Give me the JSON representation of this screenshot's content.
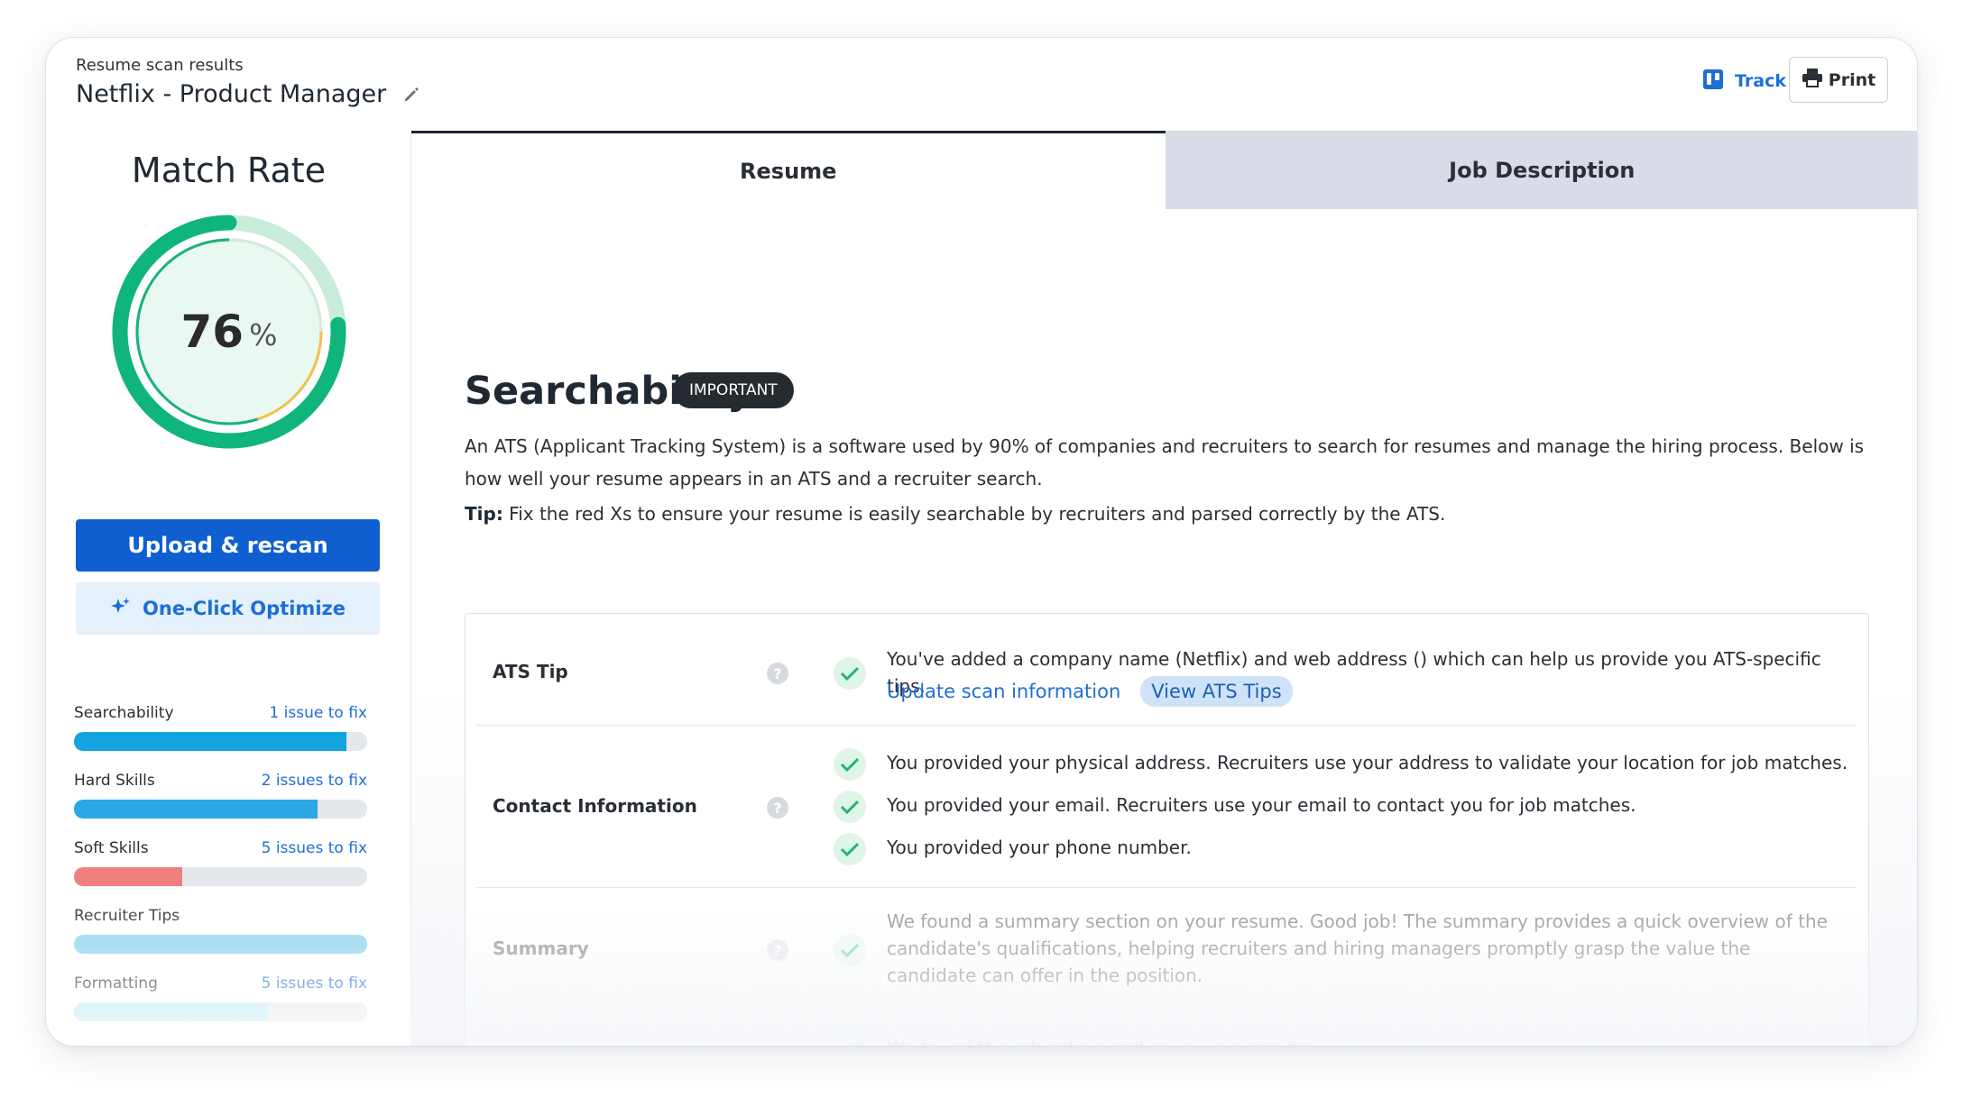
{
  "header": {
    "subtitle": "Resume scan results",
    "title": "Netflix - Product Manager",
    "track_label": "Track",
    "print_label": "Print"
  },
  "sidebar": {
    "match_title": "Match Rate",
    "match_value": "76",
    "match_unit": "%",
    "match_fraction": 0.76,
    "upload_label": "Upload & rescan",
    "optimize_label": "One-Click Optimize",
    "categories": [
      {
        "name": "Searchability",
        "issues": "1 issue to fix",
        "fill": 0.93,
        "color": "#12a3e0"
      },
      {
        "name": "Hard Skills",
        "issues": "2 issues to fix",
        "fill": 0.83,
        "color": "#2ba7e4"
      },
      {
        "name": "Soft Skills",
        "issues": "5 issues to fix",
        "fill": 0.37,
        "color": "#f08080"
      },
      {
        "name": "Recruiter Tips",
        "issues": "",
        "fill": 1.0,
        "color": "#8fd1f0"
      },
      {
        "name": "Formatting",
        "issues": "5 issues to fix",
        "fill": 0.66,
        "color": "#b9e4f6"
      }
    ]
  },
  "tabs": [
    {
      "label": "Resume",
      "active": true
    },
    {
      "label": "Job Description",
      "active": false
    }
  ],
  "main": {
    "section_title": "Searchability",
    "badge": "IMPORTANT",
    "description": "An ATS (Applicant Tracking System) is a software used by 90% of companies and recruiters to search for resumes and manage the hiring process. Below is how well your resume appears in an ATS and a recruiter search.",
    "tip_label": "Tip:",
    "tip_text": " Fix the red Xs to ensure your resume is easily searchable by recruiters and parsed correctly by the ATS.",
    "rows": {
      "ats_tip": {
        "label": "ATS Tip",
        "message": "You've added a company name (Netflix) and web address () which can help us provide you ATS-specific tips.",
        "link": "Update scan information",
        "pill": "View ATS Tips"
      },
      "contact": {
        "label": "Contact Information",
        "messages": [
          "You provided your physical address. Recruiters use your address to validate your location for job matches.",
          "You provided your email. Recruiters use your email to contact you for job matches.",
          "You provided your phone number."
        ]
      },
      "summary": {
        "label": "Summary",
        "message": "We found a summary section on your resume. Good job! The summary provides a quick overview of the candidate's qualifications, helping recruiters and hiring managers promptly grasp the value the candidate can offer in the position."
      },
      "education": {
        "message": "We found the education section in your resume."
      }
    }
  },
  "colors": {
    "primary": "#0f5fd1",
    "gauge_green": "#0fb57a",
    "gauge_yellow": "#f2c14e",
    "check_green": "#22b573"
  }
}
